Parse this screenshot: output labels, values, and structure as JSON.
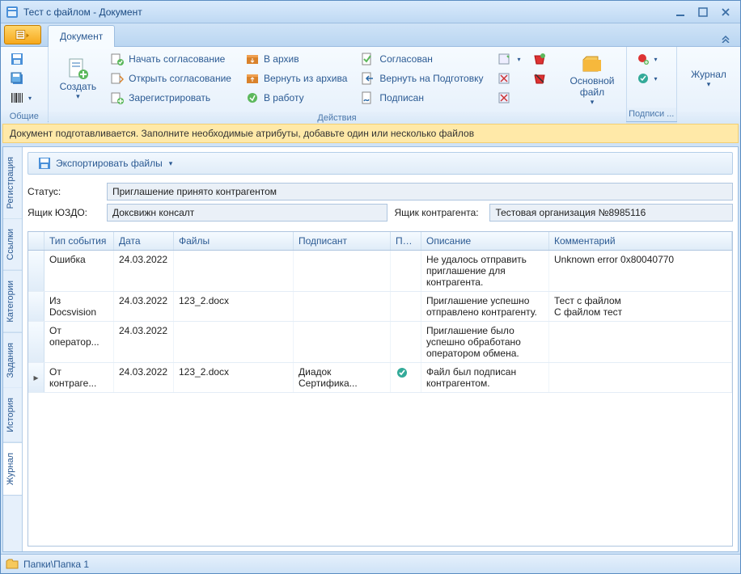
{
  "window": {
    "title": "Тест с файлом - Документ"
  },
  "ribbon": {
    "tab_document": "Документ",
    "group_common": "Общие",
    "group_actions": "Действия",
    "group_signatures": "Подписи ...",
    "create": "Создать",
    "start_approval": "Начать согласование",
    "open_approval": "Открыть согласование",
    "register": "Зарегистрировать",
    "to_archive": "В архив",
    "from_archive": "Вернуть из архива",
    "to_work": "В работу",
    "approved": "Согласован",
    "return_prepare": "Вернуть на Подготовку",
    "signed": "Подписан",
    "main_file": "Основной\nфайл",
    "journal": "Журнал"
  },
  "infobar": "Документ подготавливается. Заполните необходимые атрибуты, добавьте один или несколько файлов",
  "side_tabs": {
    "registration": "Регистрация",
    "links": "Ссылки",
    "categories": "Категории",
    "tasks": "Задания",
    "history": "История",
    "journal": "Журнал"
  },
  "toolbar": {
    "export_files": "Экспортировать файлы"
  },
  "form": {
    "status_label": "Статус:",
    "status_value": "Приглашение принято контрагентом",
    "box_label": "Ящик ЮЗДО:",
    "box_value": "Доксвижн консалт",
    "counter_box_label": "Ящик контрагента:",
    "counter_box_value": "Тестовая организация №8985116"
  },
  "grid": {
    "headers": {
      "type": "Тип события",
      "date": "Дата",
      "files": "Файлы",
      "signer": "Подписант",
      "pro": "Про...",
      "desc": "Описание",
      "comment": "Комментарий"
    },
    "rows": [
      {
        "type": "Ошибка",
        "date": "24.03.2022",
        "files": "",
        "signer": "",
        "pro": "",
        "desc": "Не удалось отправить приглашение для контрагента.",
        "comment": "Unknown error 0x80040770"
      },
      {
        "type": "Из Docsvision",
        "date": "24.03.2022",
        "files": "123_2.docx",
        "signer": "",
        "pro": "",
        "desc": "Приглашение успешно отправлено контрагенту.",
        "comment": "Тест с файлом\nС файлом тест"
      },
      {
        "type": "От оператор...",
        "date": "24.03.2022",
        "files": "",
        "signer": "",
        "pro": "",
        "desc": "Приглашение было успешно обработано оператором обмена.",
        "comment": ""
      },
      {
        "type": "От контраге...",
        "date": "24.03.2022",
        "files": "123_2.docx",
        "signer": "Диадок Сертифика...",
        "pro": "icon",
        "desc": "Файл был подписан контрагентом.",
        "comment": "",
        "current": true
      }
    ]
  },
  "statusbar": {
    "path": "Папки\\Папка 1"
  }
}
